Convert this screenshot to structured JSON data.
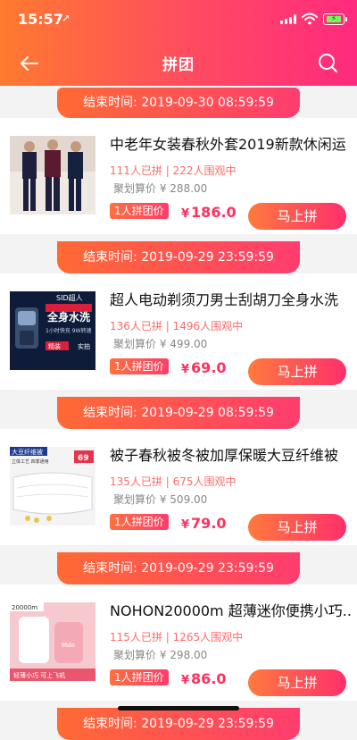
{
  "status": {
    "time": "15:57",
    "location_arrow": "➚"
  },
  "header": {
    "title": "拼团",
    "back_icon": "back-arrow-icon",
    "search_icon": "search-icon"
  },
  "labels": {
    "end_time_prefix": "结束时间:",
    "badge": "1人拼团价",
    "buy_button": "马上拼",
    "yen": "¥"
  },
  "deals": [
    {
      "end_time": "2019-09-30 08:59:59",
      "title": "中老年女装春秋外套2019新款休闲运",
      "joined": "111人已拼",
      "watching": "222人围观中",
      "orig_price_label": "聚划算价",
      "orig_price": "¥ 288.00",
      "price": "186.0"
    },
    {
      "end_time": "2019-09-29 23:59:59",
      "title": "超人电动剃须刀男士刮胡刀全身水洗",
      "joined": "136人已拼",
      "watching": "1496人围观中",
      "orig_price_label": "聚划算价",
      "orig_price": "¥ 499.00",
      "price": "69.0",
      "image_text": {
        "brand": "SID超人",
        "line1": "全身水洗",
        "line2": "1小时快充 9W转速",
        "line3": "实拍",
        "badge": "精装"
      }
    },
    {
      "end_time": "2019-09-29 08:59:59",
      "title": "被子春秋被冬被加厚保暖大豆纤维被",
      "joined": "135人已拼",
      "watching": "675人围观中",
      "orig_price_label": "聚划算价",
      "orig_price": "¥ 509.00",
      "price": "79.0",
      "image_text": {
        "tag": "大豆纤维被",
        "sub": "立体工艺 四季通用",
        "price": "69"
      }
    },
    {
      "end_time": "2019-09-29 23:59:59",
      "title": "NOHON20000m 超薄迷你便携小巧...",
      "joined": "115人已拼",
      "watching": "1265人围观中",
      "orig_price_label": "聚划算价",
      "orig_price": "¥ 298.00",
      "price": "86.0",
      "image_text": {
        "cap": "20000m",
        "foot": "轻薄小巧  可上飞机",
        "mid": "Mdo"
      }
    },
    {
      "end_time": "2019-09-29 23:59:59"
    }
  ]
}
